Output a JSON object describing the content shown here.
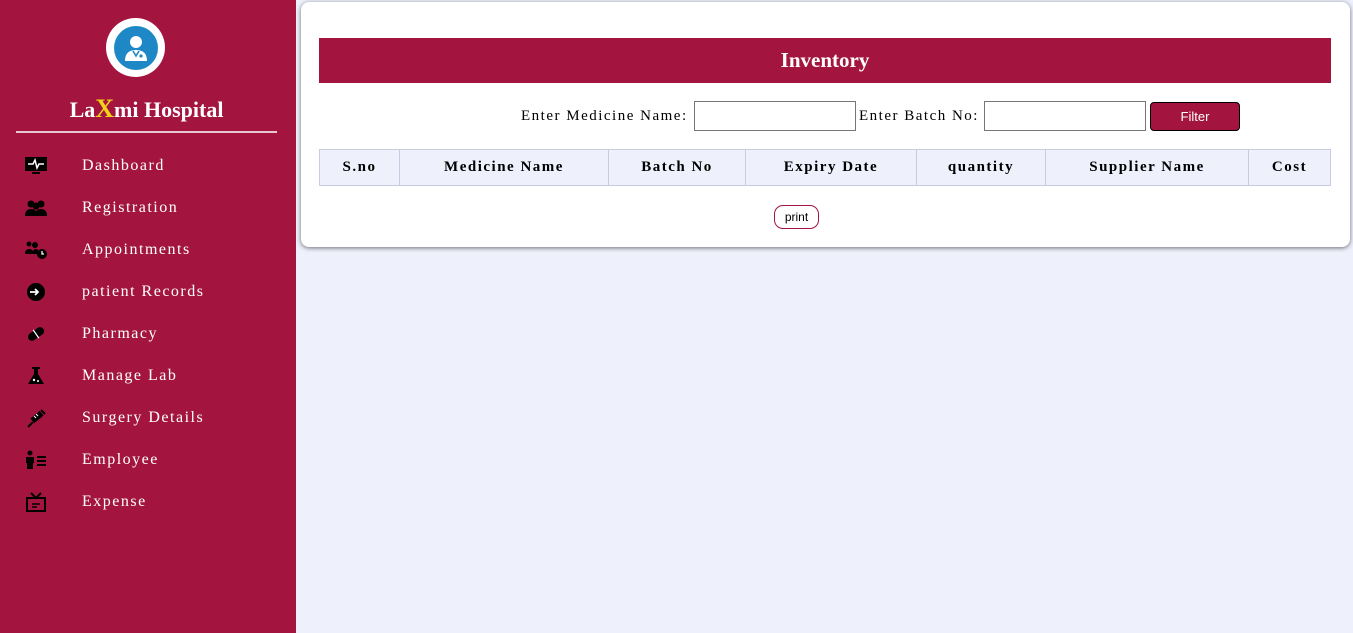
{
  "brand": {
    "prefix": "La",
    "highlight": "X",
    "suffix": "mi Hospital"
  },
  "sidebar": {
    "items": [
      {
        "label": "Dashboard",
        "icon": "monitor-icon"
      },
      {
        "label": "Registration",
        "icon": "users-icon"
      },
      {
        "label": "Appointments",
        "icon": "users-clock-icon"
      },
      {
        "label": "patient Records",
        "icon": "sign-in-icon"
      },
      {
        "label": "Pharmacy",
        "icon": "pill-icon"
      },
      {
        "label": "Manage Lab",
        "icon": "flask-icon"
      },
      {
        "label": "Surgery Details",
        "icon": "syringe-icon"
      },
      {
        "label": "Employee",
        "icon": "person-list-icon"
      },
      {
        "label": "Expense",
        "icon": "expense-icon"
      }
    ]
  },
  "main": {
    "title": "Inventory",
    "filter": {
      "medicine_label": "Enter Medicine Name:",
      "medicine_value": "",
      "batch_label": "Enter Batch No:",
      "batch_value": "",
      "button": "Filter"
    },
    "table": {
      "columns": [
        "S.no",
        "Medicine Name",
        "Batch No",
        "Expiry Date",
        "quantity",
        "Supplier Name",
        "Cost"
      ]
    },
    "print_label": "print"
  },
  "colors": {
    "primary": "#a3153f",
    "background": "#eef0fc",
    "accent": "#f1d31b",
    "logo_blue": "#1e88c7"
  }
}
